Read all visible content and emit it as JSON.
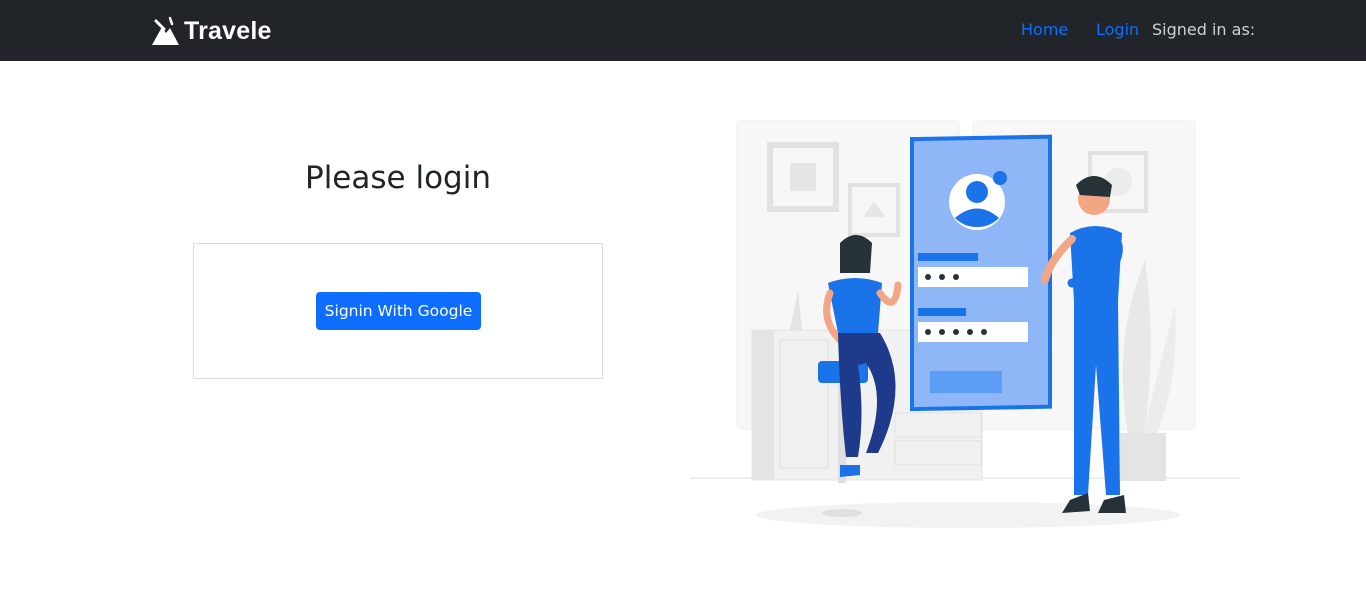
{
  "navbar": {
    "brand": "Travele",
    "links": {
      "home": "Home",
      "login": "Login"
    },
    "signed_in_text": "Signed in as:"
  },
  "main": {
    "title": "Please login",
    "google_button_label": "Signin With Google"
  },
  "illustration": {
    "icon": "login-illustration",
    "accent_color": "#1a73e8"
  },
  "colors": {
    "navbar_bg": "#212529",
    "primary": "#0d6efd",
    "text": "#212529"
  }
}
